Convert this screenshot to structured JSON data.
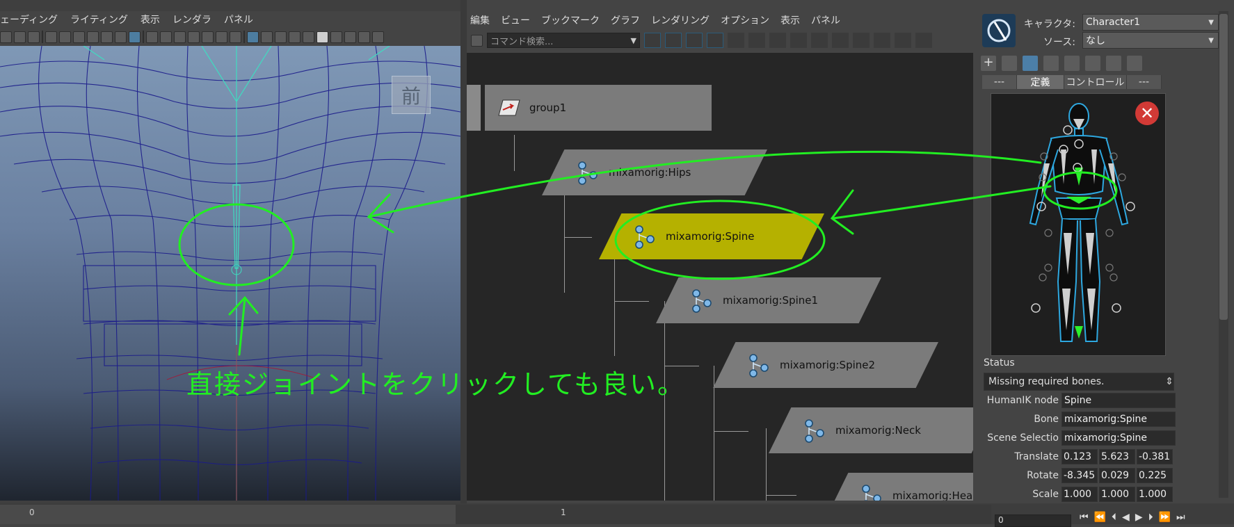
{
  "viewport": {
    "menu": [
      "ェーディング",
      "ライティング",
      "表示",
      "レンダラ",
      "パネル"
    ],
    "camera_label": "前"
  },
  "node_editor": {
    "menu": [
      "編集",
      "ビュー",
      "ブックマーク",
      "グラフ",
      "レンダリング",
      "オプション",
      "表示",
      "パネル"
    ],
    "search_placeholder": "コマンド検索...",
    "nodes": [
      {
        "label": "group1",
        "selected": false
      },
      {
        "label": "mixamorig:Hips",
        "selected": false
      },
      {
        "label": "mixamorig:Spine",
        "selected": true
      },
      {
        "label": "mixamorig:Spine1",
        "selected": false
      },
      {
        "label": "mixamorig:Spine2",
        "selected": false
      },
      {
        "label": "mixamorig:Neck",
        "selected": false
      },
      {
        "label": "mixamorig:Hea",
        "selected": false
      }
    ]
  },
  "human_ik": {
    "character_label": "キャラクタ:",
    "character_value": "Character1",
    "source_label": "ソース:",
    "source_value": "なし",
    "tabs": [
      "---",
      "定義",
      "コントロール",
      "---"
    ],
    "active_tab": "定義",
    "status_label": "Status",
    "status_value": "Missing required bones.",
    "fields": [
      {
        "label": "HumanIK node",
        "value": "Spine"
      },
      {
        "label": "Bone",
        "value": "mixamorig:Spine"
      },
      {
        "label": "Scene Selectio",
        "value": "mixamorig:Spine"
      }
    ],
    "translate": {
      "label": "Translate",
      "values": [
        "0.123",
        "5.623",
        "-0.381"
      ]
    },
    "rotate": {
      "label": "Rotate",
      "values": [
        "-8.345",
        "0.029",
        "0.225"
      ]
    },
    "scale": {
      "label": "Scale",
      "values": [
        "1.000",
        "1.000",
        "1.000"
      ]
    }
  },
  "timeline": {
    "start_tick": "0",
    "tick_1": "1",
    "current_frame": "0"
  },
  "annotation": {
    "text": "直接ジョイントをクリックしても良い。",
    "color": "#22ee22"
  },
  "colors": {
    "selected_node": "#b5b100",
    "node": "#7b7b7b",
    "joint_icon": "#7fb8e8"
  }
}
